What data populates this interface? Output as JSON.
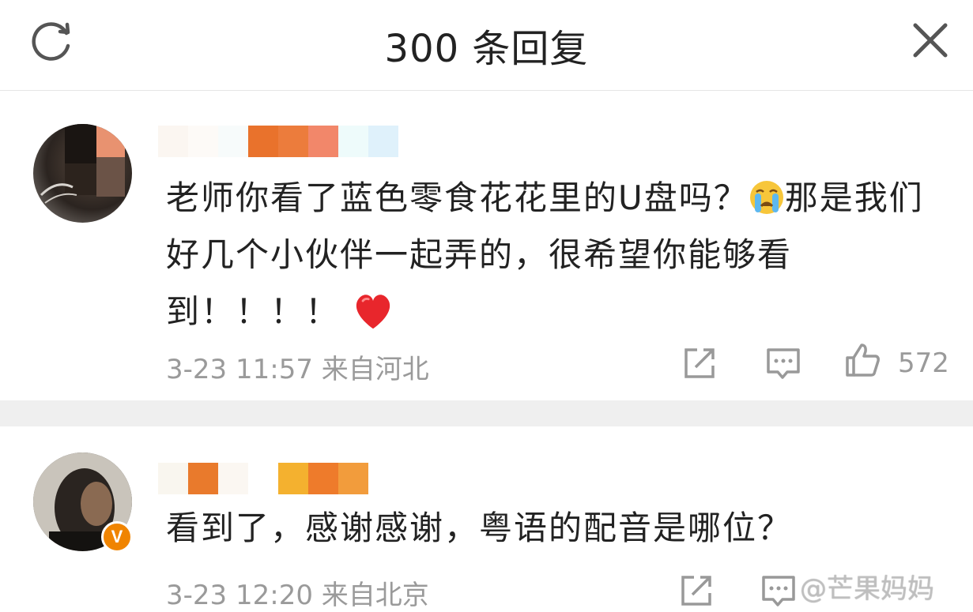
{
  "header": {
    "title": "300 条回复"
  },
  "comments": [
    {
      "text_before_emoji": "老师你看了蓝色零食花花里的U盘吗？",
      "text_after_emoji": "那是我们好几个小伙伴一起弄的，很希望你能够看到！！！！",
      "emojis": [
        "crying-face",
        "red-heart"
      ],
      "meta": "3-23 11:57 来自河北",
      "like_count": "572"
    },
    {
      "text": "看到了，感谢感谢，粤语的配音是哪位？",
      "meta": "3-23 12:20 来自北京",
      "verified_badge": "V"
    }
  ],
  "watermark": "@芒果妈妈",
  "colors": {
    "accent_badge": "#f08400",
    "meta_gray": "#9a9a9a"
  }
}
